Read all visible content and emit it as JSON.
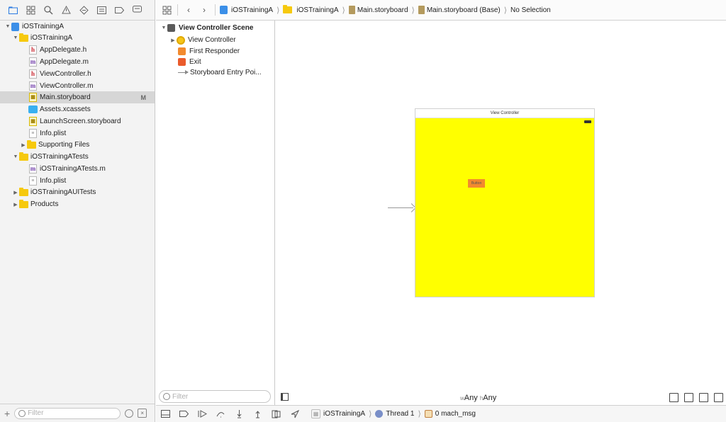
{
  "navigator": {
    "tabs": [
      "folder-icon",
      "source-control-icon",
      "search-icon",
      "warning-icon",
      "test-icon",
      "debug-icon",
      "breakpoint-icon",
      "report-icon"
    ],
    "tree": [
      {
        "label": "iOSTrainingA",
        "type": "project",
        "indent": 0,
        "expanded": true
      },
      {
        "label": "iOSTrainingA",
        "type": "folder",
        "indent": 1,
        "expanded": true
      },
      {
        "label": "AppDelegate.h",
        "type": "h",
        "indent": 2
      },
      {
        "label": "AppDelegate.m",
        "type": "m",
        "indent": 2
      },
      {
        "label": "ViewController.h",
        "type": "h",
        "indent": 2
      },
      {
        "label": "ViewController.m",
        "type": "m",
        "indent": 2
      },
      {
        "label": "Main.storyboard",
        "type": "sb",
        "indent": 2,
        "selected": true,
        "badge": "M"
      },
      {
        "label": "Assets.xcassets",
        "type": "assets",
        "indent": 2
      },
      {
        "label": "LaunchScreen.storyboard",
        "type": "sb",
        "indent": 2
      },
      {
        "label": "Info.plist",
        "type": "plist",
        "indent": 2
      },
      {
        "label": "Supporting Files",
        "type": "folder",
        "indent": 2,
        "collapsed": true
      },
      {
        "label": "iOSTrainingATests",
        "type": "folder",
        "indent": 1,
        "expanded": true
      },
      {
        "label": "iOSTrainingATests.m",
        "type": "m",
        "indent": 2
      },
      {
        "label": "Info.plist",
        "type": "plist",
        "indent": 2
      },
      {
        "label": "iOSTrainingAUITests",
        "type": "folder",
        "indent": 1,
        "collapsed": true
      },
      {
        "label": "Products",
        "type": "folder",
        "indent": 1,
        "collapsed": true
      }
    ],
    "filter_placeholder": "Filter"
  },
  "jumpbar": {
    "crumbs": [
      "iOSTrainingA",
      "iOSTrainingA",
      "Main.storyboard",
      "Main.storyboard (Base)",
      "No Selection"
    ]
  },
  "outline": {
    "scene_title": "View Controller Scene",
    "items": [
      "View Controller",
      "First Responder",
      "Exit",
      "Storyboard Entry Poi..."
    ],
    "filter_placeholder": "Filter"
  },
  "canvas": {
    "vc_title": "View Controller",
    "button_label": "Button",
    "view_color": "#ffff00",
    "size_w_prefix": "w",
    "size_w_value": "Any",
    "size_h_prefix": "h",
    "size_h_value": "Any"
  },
  "debugbar": {
    "target": "iOSTrainingA",
    "thread": "Thread 1",
    "frame": "0 mach_msg"
  }
}
